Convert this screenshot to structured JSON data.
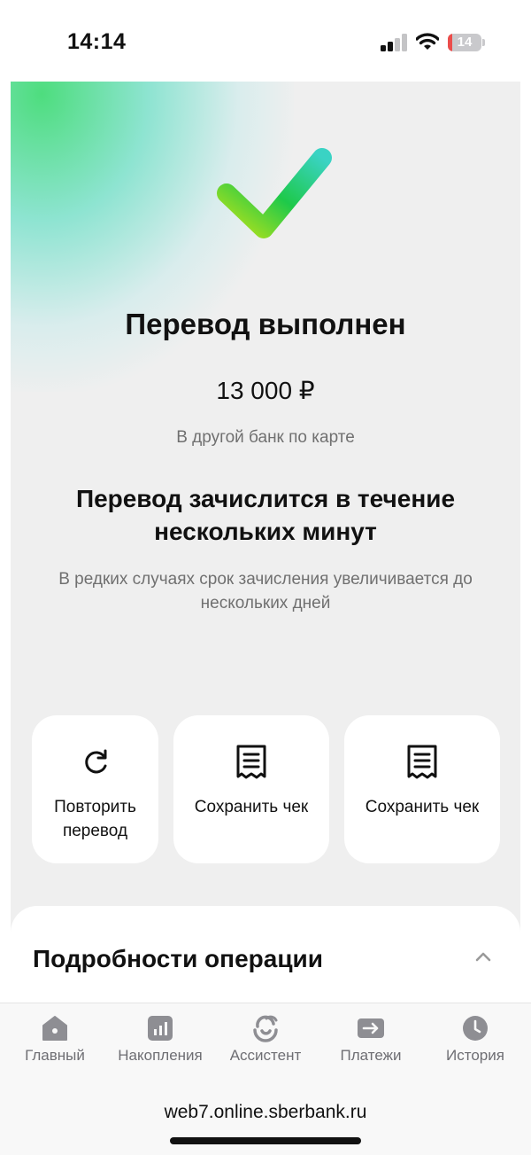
{
  "status_bar": {
    "time": "14:14",
    "battery": "14",
    "battery_level": 0.14,
    "battery_color": "#eb4d4b"
  },
  "result": {
    "title": "Перевод выполнен",
    "amount": "13 000 ₽",
    "subtitle": "В другой банк по карте",
    "info_heading": "Перевод зачислится в течение нескольких минут",
    "info_text": "В редких случаях срок зачисления увеличивается до нескольких дней",
    "accent": "#21c04a"
  },
  "actions": [
    {
      "label": "Повторить перевод",
      "icon": "refresh-icon"
    },
    {
      "label": "Сохранить чек",
      "icon": "receipt-icon"
    },
    {
      "label": "Сохранить чек",
      "icon": "receipt-icon"
    }
  ],
  "details": {
    "title": "Подробности операции",
    "icon": "chevron-up-icon"
  },
  "tabs": [
    {
      "label": "Главный",
      "icon": "home-icon"
    },
    {
      "label": "Накопления",
      "icon": "savings-chart-icon"
    },
    {
      "label": "Ассистент",
      "icon": "assistant-icon"
    },
    {
      "label": "Платежи",
      "icon": "payments-arrow-icon"
    },
    {
      "label": "История",
      "icon": "clock-icon"
    }
  ],
  "browser": {
    "url": "web7.online.sberbank.ru"
  }
}
